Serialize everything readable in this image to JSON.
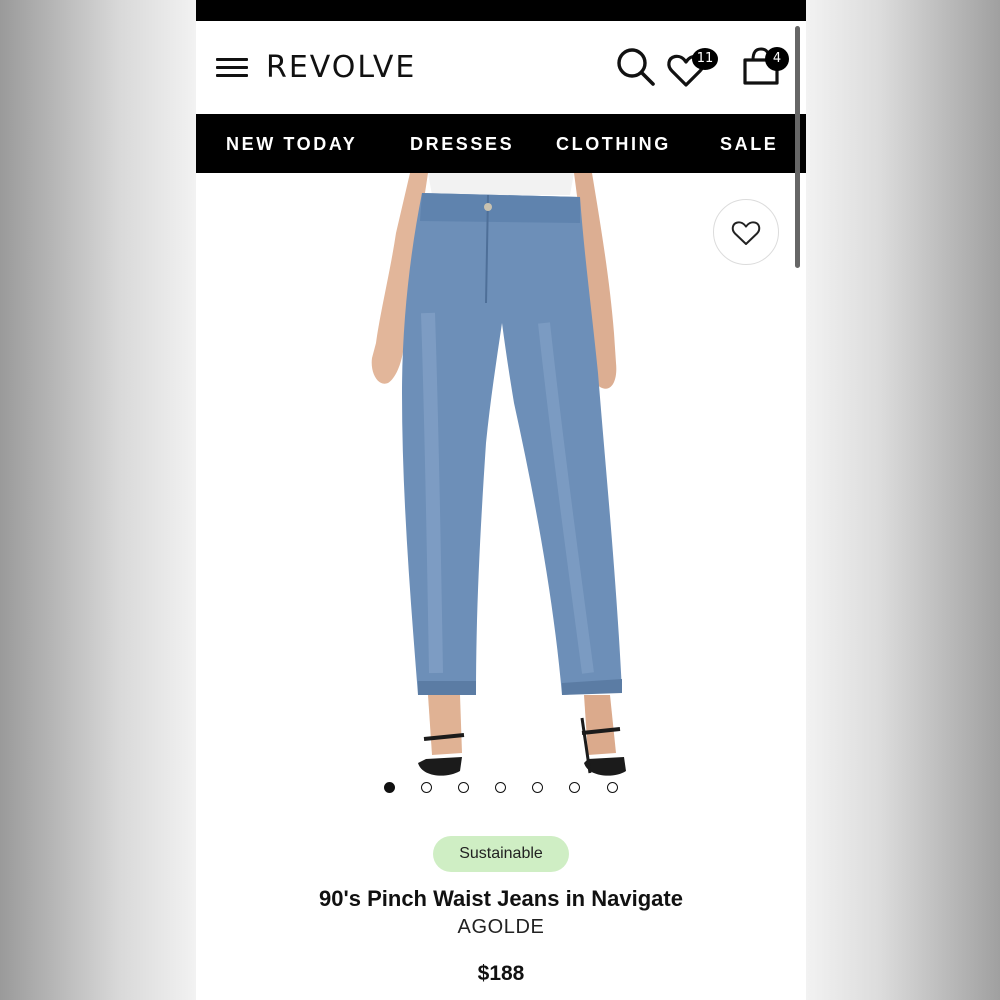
{
  "header": {
    "logo": "REVOLVE",
    "wishlist_count": "11",
    "bag_count": "4"
  },
  "nav": {
    "items": [
      "NEW TODAY",
      "DRESSES",
      "CLOTHING",
      "SALE"
    ]
  },
  "product": {
    "image_icon": "jeans-product-photo",
    "favorite_icon": "heart-outline-icon",
    "image_count": 7,
    "active_image_index": 0,
    "tag": "Sustainable",
    "name": "90's Pinch Waist Jeans in Navigate",
    "brand": "AGOLDE",
    "price": "$188"
  },
  "colors": {
    "black": "#000000",
    "tag_bg": "#cfeec4",
    "denim": "#6d8fb8"
  }
}
